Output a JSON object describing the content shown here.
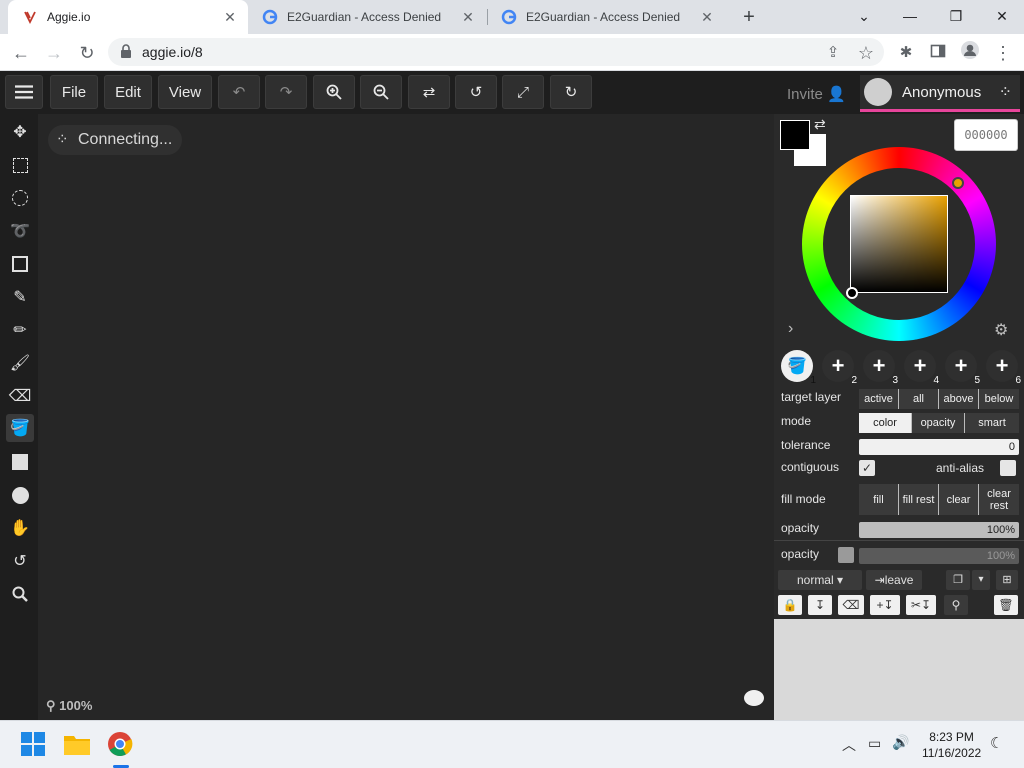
{
  "browser": {
    "tabs": [
      {
        "title": "Aggie.io",
        "active": true
      },
      {
        "title": "E2Guardian - Access Denied",
        "active": false
      },
      {
        "title": "E2Guardian - Access Denied",
        "active": false
      }
    ],
    "url": "aggie.io/8"
  },
  "menu": {
    "file": "File",
    "edit": "Edit",
    "view": "View",
    "invite": "Invite",
    "username": "Anonymous"
  },
  "canvas": {
    "status": "Connecting...",
    "zoom": "100%"
  },
  "colors": {
    "primary": "#000000",
    "secondary": "#ffffff",
    "hex_value": "000000",
    "accent": "#e8459b"
  },
  "slots": [
    "1",
    "2",
    "3",
    "4",
    "5",
    "6"
  ],
  "tool_options": {
    "target_layer_label": "target layer",
    "target_layer_options": [
      "active",
      "all",
      "above",
      "below"
    ],
    "mode_label": "mode",
    "mode_options": [
      "color",
      "opacity",
      "smart"
    ],
    "tolerance_label": "tolerance",
    "tolerance_value": "0",
    "contiguous_label": "contiguous",
    "antialias_label": "anti-alias",
    "fill_mode_label": "fill mode",
    "fill_mode_options": [
      "fill",
      "fill rest",
      "clear",
      "clear rest"
    ],
    "opacity_label": "opacity",
    "opacity_value": "100%"
  },
  "layer": {
    "opacity_label": "opacity",
    "opacity_value": "100%",
    "blend_mode": "normal",
    "leave_label": "leave"
  },
  "taskbar": {
    "time": "8:23 PM",
    "date": "11/16/2022"
  }
}
